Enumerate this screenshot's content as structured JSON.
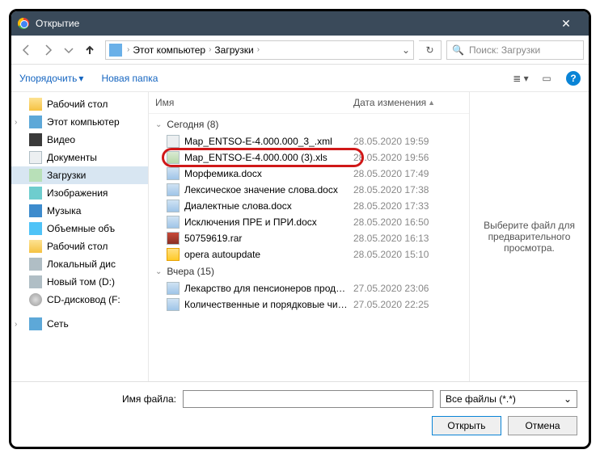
{
  "window": {
    "title": "Открытие"
  },
  "nav": {
    "breadcrumb": [
      "Этот компьютер",
      "Загрузки"
    ],
    "search_placeholder": "Поиск: Загрузки"
  },
  "toolbar": {
    "organize": "Упорядочить",
    "new_folder": "Новая папка"
  },
  "sidebar": {
    "items": [
      {
        "label": "Рабочий стол",
        "icon": "i-desktop"
      },
      {
        "label": "Этот компьютер",
        "icon": "i-pc",
        "expandable": true
      },
      {
        "label": "Видео",
        "icon": "i-video"
      },
      {
        "label": "Документы",
        "icon": "i-doc"
      },
      {
        "label": "Загрузки",
        "icon": "i-down",
        "active": true
      },
      {
        "label": "Изображения",
        "icon": "i-img"
      },
      {
        "label": "Музыка",
        "icon": "i-music"
      },
      {
        "label": "Объемные объ",
        "icon": "i-3d"
      },
      {
        "label": "Рабочий стол",
        "icon": "i-desktop"
      },
      {
        "label": "Локальный дис",
        "icon": "i-disk"
      },
      {
        "label": "Новый том (D:)",
        "icon": "i-disk"
      },
      {
        "label": "CD-дисковод (F:",
        "icon": "i-cd"
      },
      {
        "label": "Сеть",
        "icon": "i-net",
        "expandable": true,
        "sep": true
      }
    ]
  },
  "columns": {
    "name": "Имя",
    "date": "Дата изменения"
  },
  "groups": [
    {
      "label": "Сегодня (8)",
      "files": [
        {
          "name": "Map_ENTSO-E-4.000.000_3_.xml",
          "date": "28.05.2020 19:59",
          "type": "xml"
        },
        {
          "name": "Map_ENTSO-E-4.000.000 (3).xls",
          "date": "28.05.2020 19:56",
          "type": "xls",
          "highlight": true
        },
        {
          "name": "Морфемика.docx",
          "date": "28.05.2020 17:49",
          "type": "docx"
        },
        {
          "name": "Лексическое значение слова.docx",
          "date": "28.05.2020 17:38",
          "type": "docx"
        },
        {
          "name": "Диалектные слова.docx",
          "date": "28.05.2020 17:33",
          "type": "docx"
        },
        {
          "name": "Исключения ПРЕ и ПРИ.docx",
          "date": "28.05.2020 16:50",
          "type": "docx"
        },
        {
          "name": "50759619.rar",
          "date": "28.05.2020 16:13",
          "type": "rar"
        },
        {
          "name": "opera autoupdate",
          "date": "28.05.2020 15:10",
          "type": "folder"
        }
      ]
    },
    {
      "label": "Вчера (15)",
      "files": [
        {
          "name": "Лекарство для пенсионеров продали в ...",
          "date": "27.05.2020 23:06",
          "type": "docx"
        },
        {
          "name": "Количественные и порядковые числит...",
          "date": "27.05.2020 22:25",
          "type": "docx"
        }
      ]
    }
  ],
  "preview": {
    "text": "Выберите файл для предварительного просмотра."
  },
  "bottom": {
    "filename_label": "Имя файла:",
    "filename_value": "",
    "filter": "Все файлы (*.*)",
    "open": "Открыть",
    "cancel": "Отмена"
  }
}
